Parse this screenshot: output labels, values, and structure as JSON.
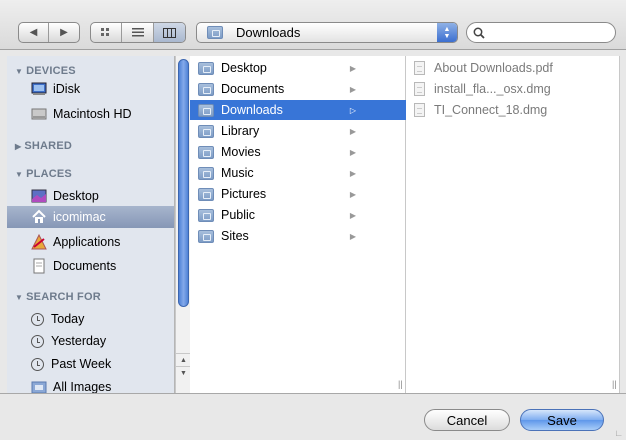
{
  "toolbar": {
    "current_folder": "Downloads",
    "search": {
      "value": "",
      "placeholder": ""
    }
  },
  "sidebar": {
    "devices_header": "DEVICES",
    "devices": [
      "iDisk",
      "Macintosh HD"
    ],
    "shared_header": "SHARED",
    "places_header": "PLACES",
    "places": [
      "Desktop",
      "icomimac",
      "Applications",
      "Documents"
    ],
    "search_header": "SEARCH FOR",
    "searches": [
      "Today",
      "Yesterday",
      "Past Week",
      "All Images"
    ]
  },
  "column1": {
    "items": [
      "Desktop",
      "Documents",
      "Downloads",
      "Library",
      "Movies",
      "Music",
      "Pictures",
      "Public",
      "Sites"
    ],
    "selected": "Downloads"
  },
  "column2": {
    "files": [
      "About Downloads.pdf",
      "install_fla..._osx.dmg",
      "TI_Connect_18.dmg"
    ]
  },
  "buttons": {
    "cancel": "Cancel",
    "save": "Save"
  },
  "colors": {
    "selection": "#3875d7",
    "sidebar_bg": "#e1e6ee",
    "sidebar_selection": "#8c9cb9"
  }
}
